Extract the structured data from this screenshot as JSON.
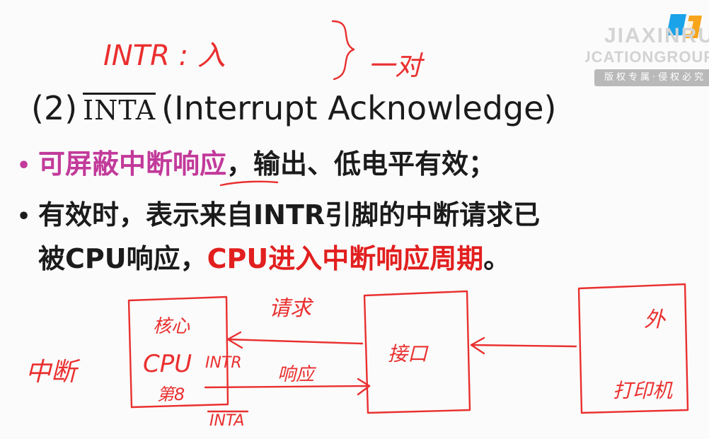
{
  "watermark": {
    "line1": "JIAXINRU",
    "line2": "EDUCATIONGROUP",
    "badge": "版权专属·侵权必究",
    "logo_colors": [
      "#1aa3e8",
      "#f7a51c"
    ]
  },
  "heading": {
    "prefix": "(2)",
    "signal": "INTA",
    "description": "(Interrupt Acknowledge)"
  },
  "bullets": [
    {
      "highlight": "可屏蔽中断响应",
      "rest": "，输出、低电平有效；"
    },
    {
      "line1": "有效时，表示来自INTR引脚的中断请求已",
      "line2_prefix": "被CPU响应，",
      "line2_highlight": "CPU进入中断响应周期",
      "line2_suffix": "。"
    }
  ],
  "handwriting": {
    "top_note": "INTR : 入",
    "pair_note": "一对",
    "request_label": "请求",
    "response_label": "响应",
    "interrupt_label": "中断",
    "cpu_label": "CPU",
    "cpu_top": "核心",
    "cpu_bottom": "第8",
    "intr_pin": "INTR",
    "inta_pin": "INTA",
    "middle_box": "接口",
    "right_box_top": "外",
    "right_box_bottom": "打印机"
  },
  "colors": {
    "text": "#1b1b1b",
    "magenta": "#c23a9a",
    "red": "#e21f1f",
    "ink": "#ea2f2f"
  }
}
